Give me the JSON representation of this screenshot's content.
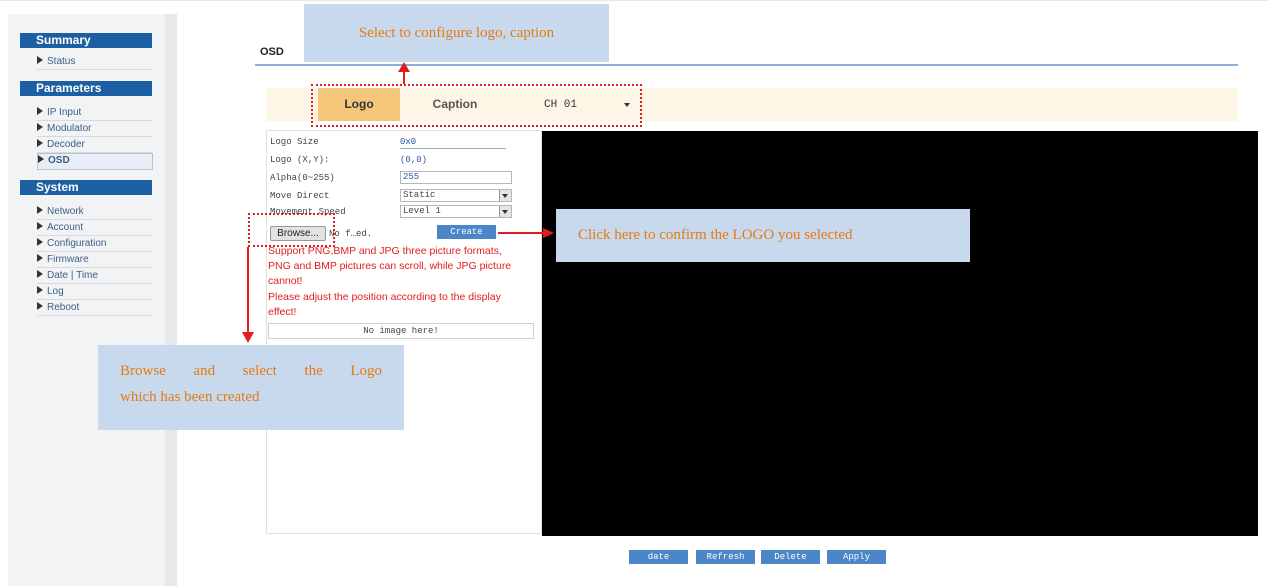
{
  "sidebar": {
    "sections": [
      {
        "title": "Summary",
        "items": [
          "Status"
        ]
      },
      {
        "title": "Parameters",
        "items": [
          "IP Input",
          "Modulator",
          "Decoder",
          "OSD"
        ]
      },
      {
        "title": "System",
        "items": [
          "Network",
          "Account",
          "Configuration",
          "Firmware",
          "Date | Time",
          "Log",
          "Reboot"
        ]
      }
    ],
    "active_item": "OSD",
    "icon": "triangle-right-icon"
  },
  "page": {
    "title": "OSD"
  },
  "tabs": {
    "logo": "Logo",
    "caption": "Caption"
  },
  "channel_select": {
    "value": "CH 01"
  },
  "form": {
    "logo_size_label": "Logo Size",
    "logo_size_value": "0x0",
    "logo_xy_label": "Logo (X,Y):",
    "logo_xy_value": "(0,0)",
    "alpha_label": "Alpha(0~255)",
    "alpha_value": "255",
    "move_direct_label": "Move Direct",
    "move_direct_value": "Static",
    "movement_speed_label": "Movement Speed",
    "movement_speed_value": "Level 1",
    "browse_label": "Browse...",
    "no_file_label": "No f…ed.",
    "create_label": "Create"
  },
  "notes": {
    "line1": "Support PNG,BMP and JPG three picture formats,",
    "line2": "PNG and BMP pictures can scroll, while JPG picture",
    "line3": "cannot!",
    "line4": "Please adjust the position according to the display",
    "line5": "effect!"
  },
  "no_image": "No image here!",
  "bottom_buttons": {
    "date": "date",
    "refresh": "Refresh",
    "delete": "Delete",
    "apply": "Apply"
  },
  "callouts": {
    "top": "Select to configure logo, caption",
    "right": "Click here to confirm the LOGO you selected",
    "left_line1": "Browse and select the Logo",
    "left_line2": "which has been created"
  },
  "colors": {
    "sidebar_header": "#1d5fa3",
    "tab_active": "#f3c777",
    "button": "#4a86c8",
    "annotation": "#e01e1e",
    "callout_bg": "#c8d9ee",
    "callout_text": "#e67a12"
  }
}
